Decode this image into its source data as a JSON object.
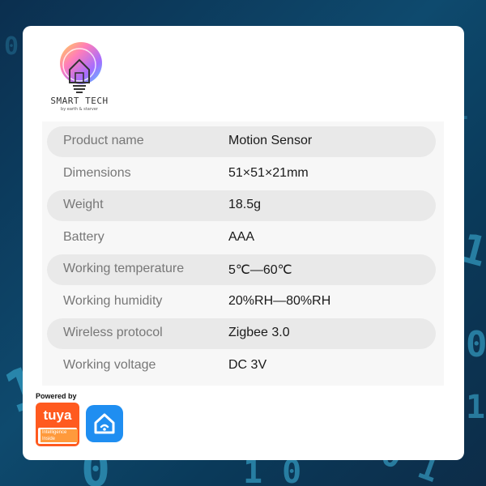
{
  "brand": {
    "name": "SMART TECH",
    "subtitle": "by earth & starver"
  },
  "specs": [
    {
      "label": "Product name",
      "value": "Motion Sensor"
    },
    {
      "label": "Dimensions",
      "value": "51×51×21mm"
    },
    {
      "label": "Weight",
      "value": "18.5g"
    },
    {
      "label": "Battery",
      "value": "AAA"
    },
    {
      "label": "Working temperature",
      "value": "5℃—60℃"
    },
    {
      "label": "Working humidity",
      "value": "20%RH—80%RH"
    },
    {
      "label": "Wireless protocol",
      "value": "Zigbee 3.0"
    },
    {
      "label": "Working voltage",
      "value": "DC  3V"
    }
  ],
  "badge": {
    "powered_by": "Powered by",
    "tuya": "tuya",
    "tag_line1": "Intelligence",
    "tag_line2": "Inside"
  },
  "colors": {
    "tuya_orange": "#ff5a1f",
    "app_blue": "#1f8ef1",
    "row_shade": "#e9e9e9"
  },
  "icons": [
    "smart-home-bulb-logo-icon",
    "smart-life-house-wifi-icon"
  ]
}
